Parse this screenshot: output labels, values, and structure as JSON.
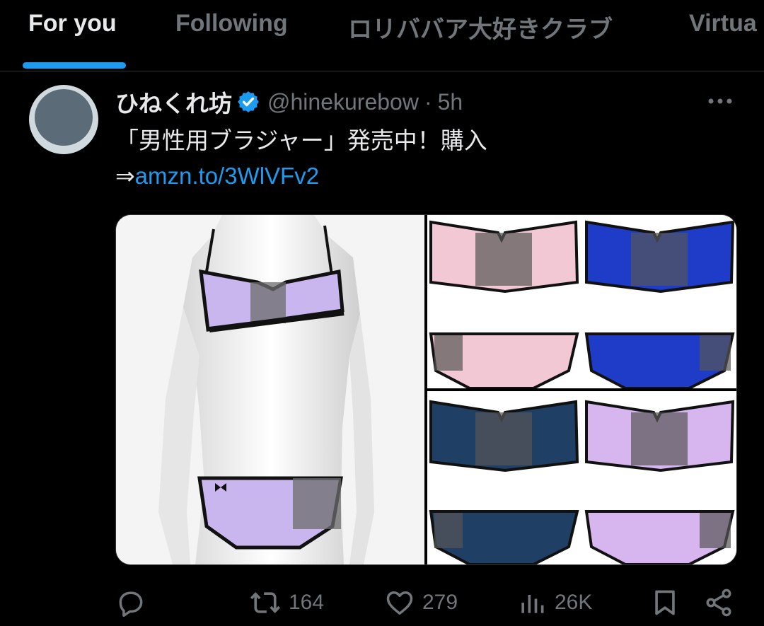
{
  "tabs": [
    {
      "label": "For you",
      "active": true
    },
    {
      "label": "Following",
      "active": false
    },
    {
      "label": "ロリババア大好きクラブ",
      "active": false
    },
    {
      "label": "Virtua",
      "active": false
    }
  ],
  "tweet": {
    "display_name": "ひねくれ坊",
    "handle": "@hinekurebow",
    "separator": "·",
    "time": "5h",
    "text_line1": "「男性用ブラジャー」発売中！購入",
    "text_arrow": "⇒",
    "link_text": "amzn.to/3WlVFv2",
    "verified": true
  },
  "actions": {
    "reply_count": "",
    "retweet_count": "164",
    "like_count": "279",
    "views_count": "26K"
  },
  "colors": {
    "accent": "#1d9bf0",
    "muted": "#71767b",
    "text": "#e7e9ea",
    "background": "#000000"
  },
  "icons": [
    "more-icon",
    "verified-icon",
    "reply-icon",
    "retweet-icon",
    "like-icon",
    "views-icon",
    "bookmark-icon",
    "share-icon"
  ]
}
